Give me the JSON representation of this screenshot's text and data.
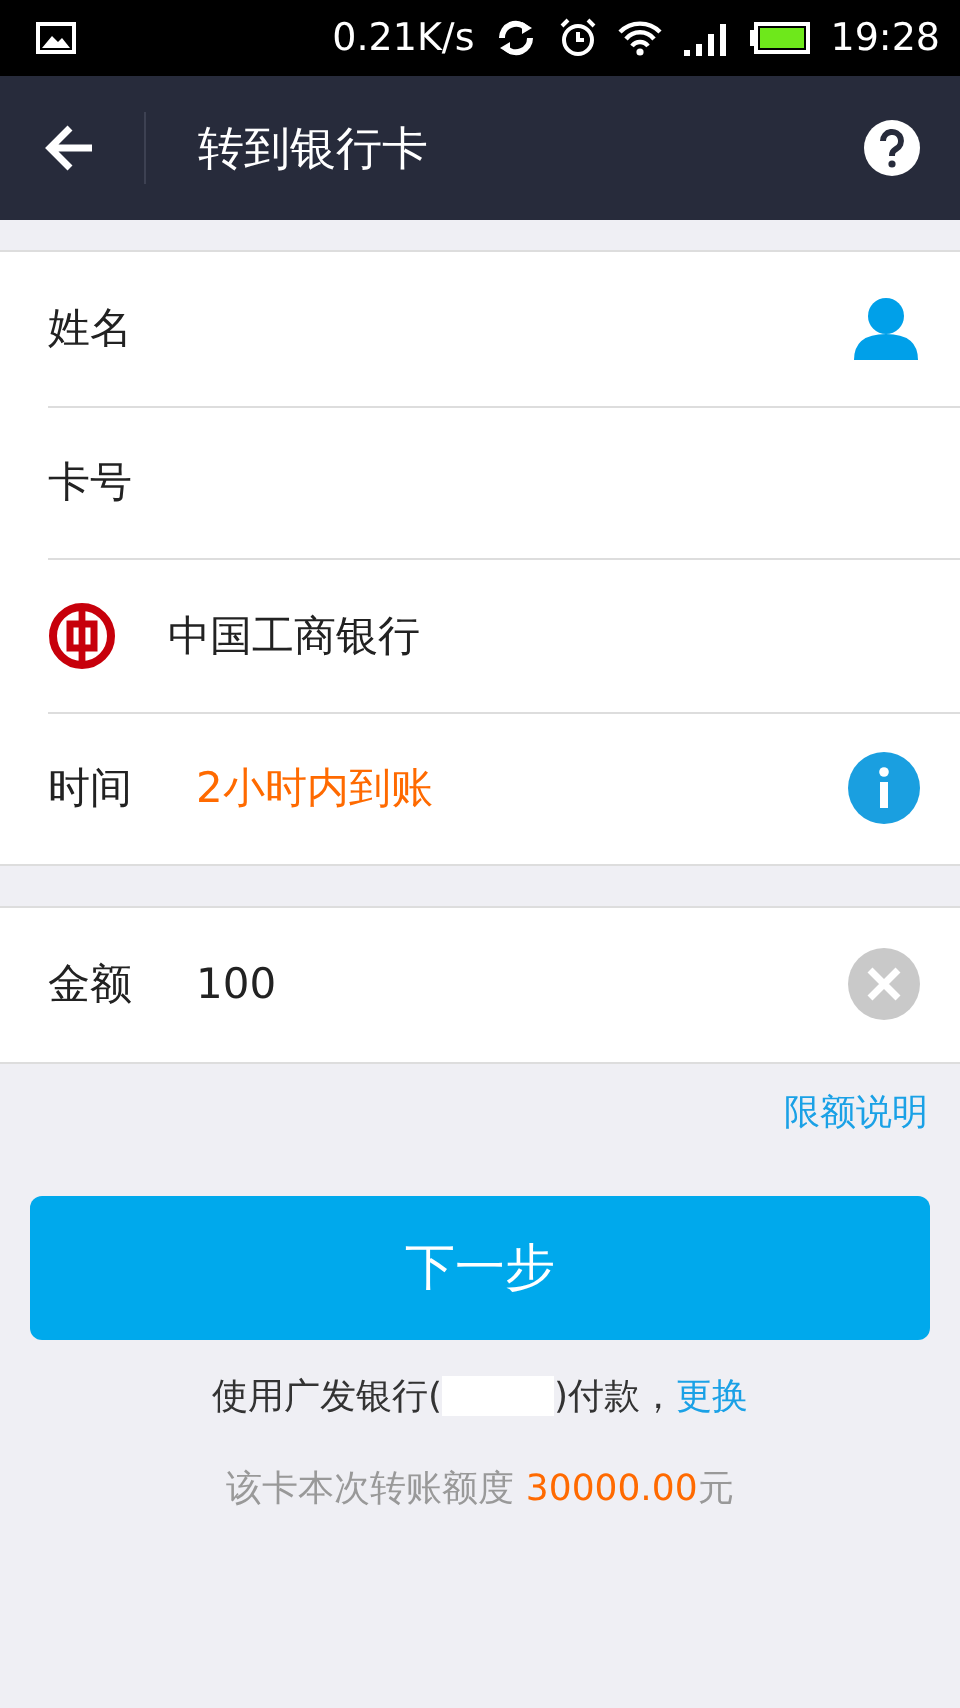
{
  "status_bar": {
    "speed": "0.21K/s",
    "time": "19:28"
  },
  "header": {
    "title": "转到银行卡"
  },
  "rows": [
    {
      "kind": "contact",
      "label": "姓名"
    },
    {
      "kind": "plain",
      "label": "卡号"
    },
    {
      "kind": "bank",
      "label": "中国工商银行"
    },
    {
      "kind": "info",
      "label": "时间",
      "value": "2小时内到账"
    }
  ],
  "amount": {
    "label": "金额",
    "value": "100"
  },
  "limit_link": "限额说明",
  "next_button": "下一步",
  "payment": {
    "before": "使用广发银行(",
    "after": ")付款，",
    "change_link": "更换"
  },
  "quota": {
    "text": "该卡本次转账额度",
    "amount": "30000.00",
    "unit": "元"
  }
}
